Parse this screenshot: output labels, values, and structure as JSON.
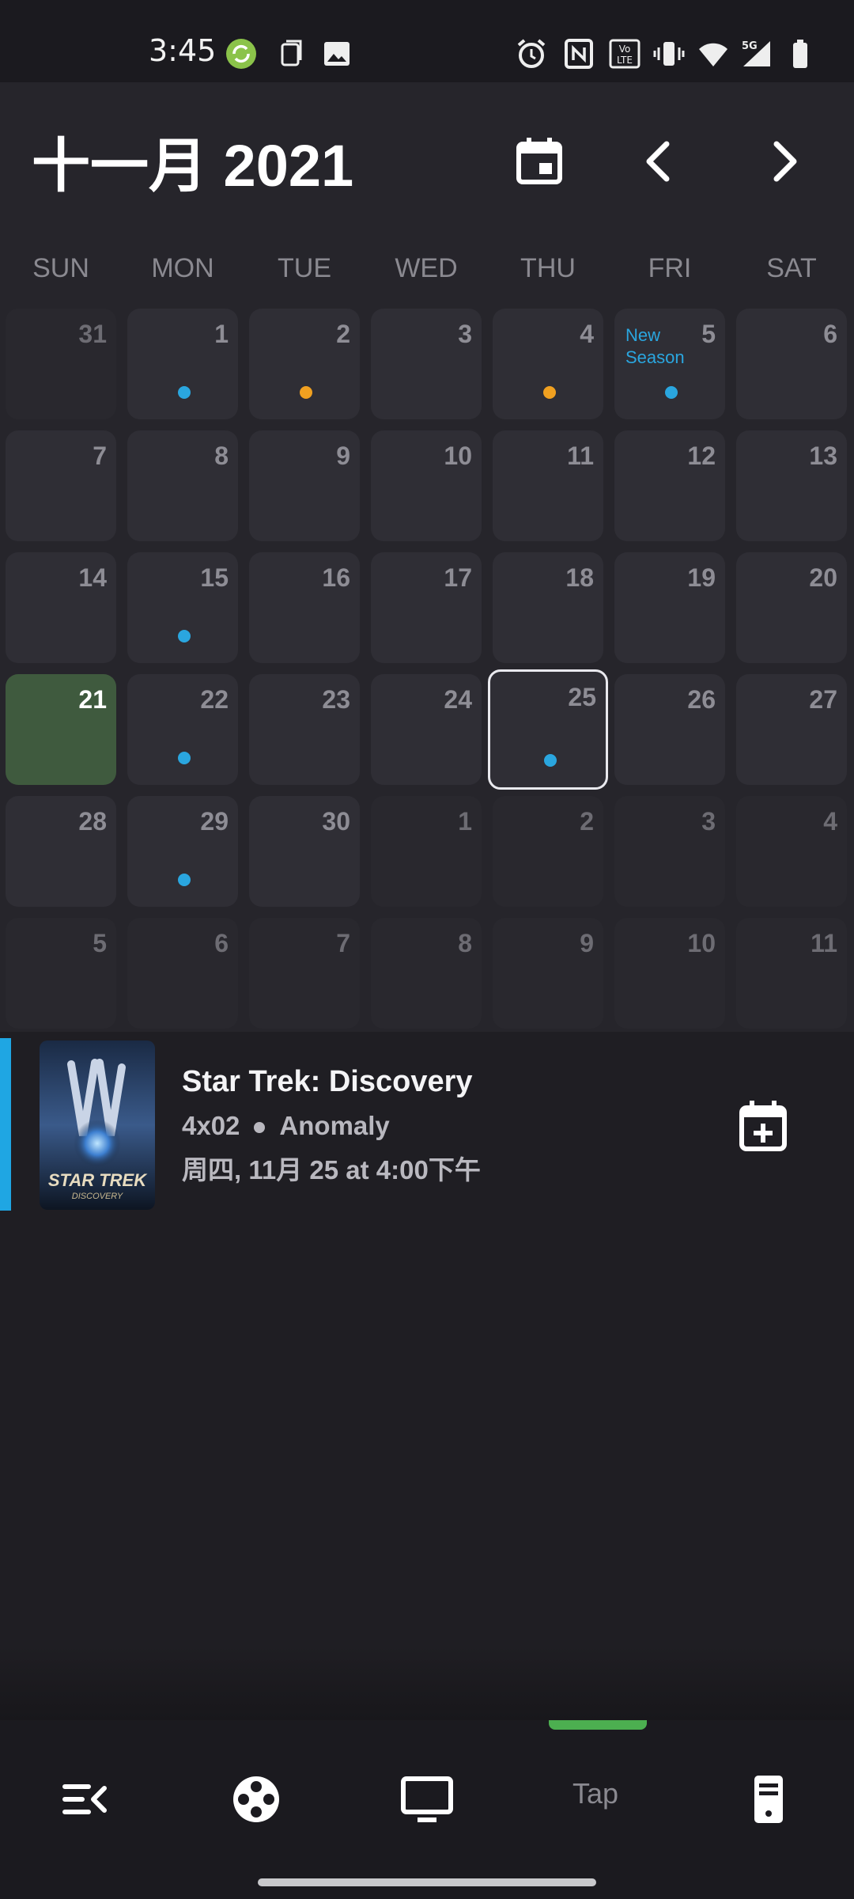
{
  "status_bar": {
    "time": "3:45"
  },
  "header": {
    "title": "十一月 2021"
  },
  "weekdays": [
    "SUN",
    "MON",
    "TUE",
    "WED",
    "THU",
    "FRI",
    "SAT"
  ],
  "calendar": {
    "rows": [
      [
        "31",
        "1",
        "2",
        "3",
        "4",
        "5",
        "6"
      ],
      [
        "7",
        "8",
        "9",
        "10",
        "11",
        "12",
        "13"
      ],
      [
        "14",
        "15",
        "16",
        "17",
        "18",
        "19",
        "20"
      ],
      [
        "21",
        "22",
        "23",
        "24",
        "25",
        "26",
        "27"
      ],
      [
        "28",
        "29",
        "30",
        "1",
        "2",
        "3",
        "4"
      ],
      [
        "5",
        "6",
        "7",
        "8",
        "9",
        "10",
        "11"
      ]
    ],
    "new_season_label": "New Season"
  },
  "episode": {
    "show": "Star Trek: Discovery",
    "number": "4x02",
    "title": "Anomaly",
    "airtime": "周四, 11月 25 at 4:00下午",
    "poster_text": "STAR TREK",
    "poster_subtext": "DISCOVERY"
  },
  "bottom_nav": {
    "tap_label": "Tap"
  },
  "colors": {
    "accent_blue": "#2aa6df",
    "accent_orange": "#f0a020",
    "today_green": "#3f5a3e",
    "nav_indicator": "#4caf50"
  }
}
